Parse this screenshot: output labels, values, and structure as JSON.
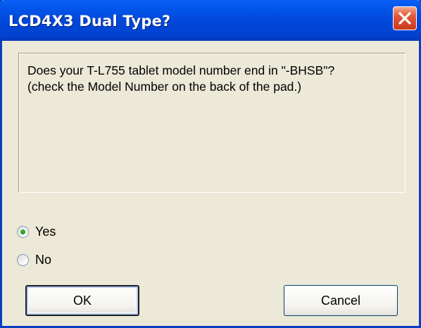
{
  "dialog": {
    "title": "LCD4X3 Dual Type?",
    "message": "Does your T-L755 tablet model number end in \"-BHSB\"?\n(check the Model Number on the back of the pad.)",
    "options": [
      {
        "label": "Yes",
        "selected": true
      },
      {
        "label": "No",
        "selected": false
      }
    ],
    "ok_label": "OK",
    "cancel_label": "Cancel"
  },
  "icons": {
    "close": "close-icon"
  },
  "colors": {
    "titlebar": "#0046D8",
    "background": "#ECE9D8",
    "close_button": "#E1583A",
    "radio_selected": "#21A121"
  }
}
